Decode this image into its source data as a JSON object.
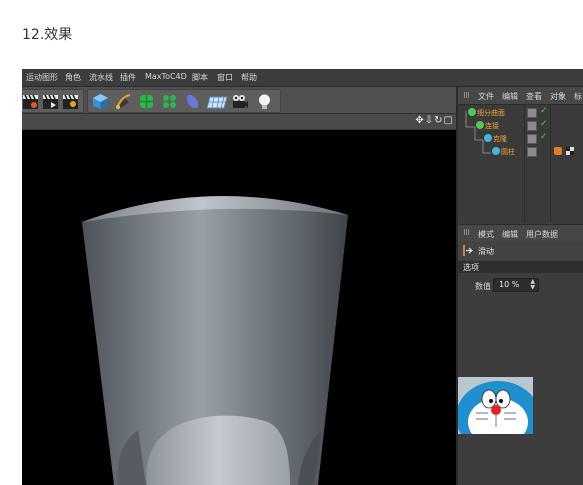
{
  "heading": "12.效果",
  "menu": [
    "运动图形",
    "角色",
    "流水线",
    "插件",
    "MaxToC4D",
    "脚本",
    "窗口",
    "帮助"
  ],
  "toolbar": {
    "tools": [
      "clapper-icon",
      "clapper-icon",
      "clapper-icon",
      "cube-icon",
      "pen-icon",
      "subdivision-icon",
      "array-icon",
      "deformer-icon",
      "floor-icon",
      "camera-icon",
      "light-icon"
    ]
  },
  "viewport": {
    "nav_icons": "✥⇩↻▢"
  },
  "object_manager": {
    "tabs": [
      "文件",
      "编辑",
      "查看",
      "对象",
      "标"
    ],
    "objects": [
      {
        "name": "细分曲面",
        "color": "#4fc957"
      },
      {
        "name": "连接",
        "color": "#4fc957"
      },
      {
        "name": "克隆",
        "color": "#47b3e0"
      },
      {
        "name": "圆柱",
        "color": "#47b3e0"
      }
    ]
  },
  "attribute_manager": {
    "tabs": [
      "模式",
      "编辑",
      "用户数据"
    ],
    "title": "滑动",
    "section": "选项",
    "param_label": "数值",
    "param_value": "10 %"
  },
  "colors": {
    "accent_orange": "#f2a23c",
    "check_green": "#36d23a",
    "background": "#3a3a3a"
  }
}
